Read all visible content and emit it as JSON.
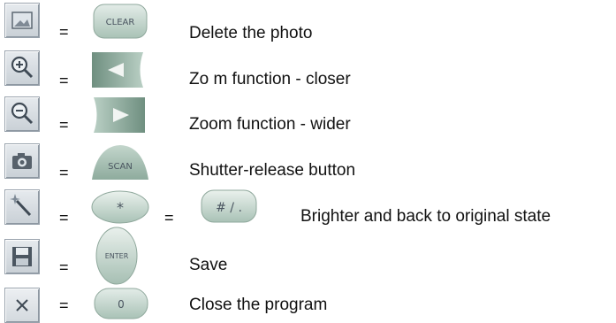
{
  "equals": "=",
  "rows": [
    {
      "icon": "image-icon",
      "keys": [
        {
          "icon": "clear-key",
          "label": "CLEAR"
        }
      ],
      "description": "Delete the photo"
    },
    {
      "icon": "zoom-in-icon",
      "keys": [
        {
          "icon": "left-arrow-key",
          "label": ""
        }
      ],
      "description": "Zo m function - closer"
    },
    {
      "icon": "zoom-out-icon",
      "keys": [
        {
          "icon": "right-arrow-key",
          "label": ""
        }
      ],
      "description": "Zoom function - wider"
    },
    {
      "icon": "camera-icon",
      "keys": [
        {
          "icon": "scan-key",
          "label": "SCAN"
        }
      ],
      "description": "Shutter-release button"
    },
    {
      "icon": "magic-wand-icon",
      "keys": [
        {
          "icon": "star-key",
          "label": "*"
        },
        {
          "icon": "hash-key",
          "label": "# / ."
        }
      ],
      "description": "Brighter and back to original state"
    },
    {
      "icon": "floppy-disk-icon",
      "keys": [
        {
          "icon": "enter-key",
          "label": "ENTER"
        }
      ],
      "description": "Save"
    },
    {
      "icon": "close-icon",
      "keys": [
        {
          "icon": "zero-key",
          "label": "0"
        }
      ],
      "description": "Close the program"
    }
  ]
}
